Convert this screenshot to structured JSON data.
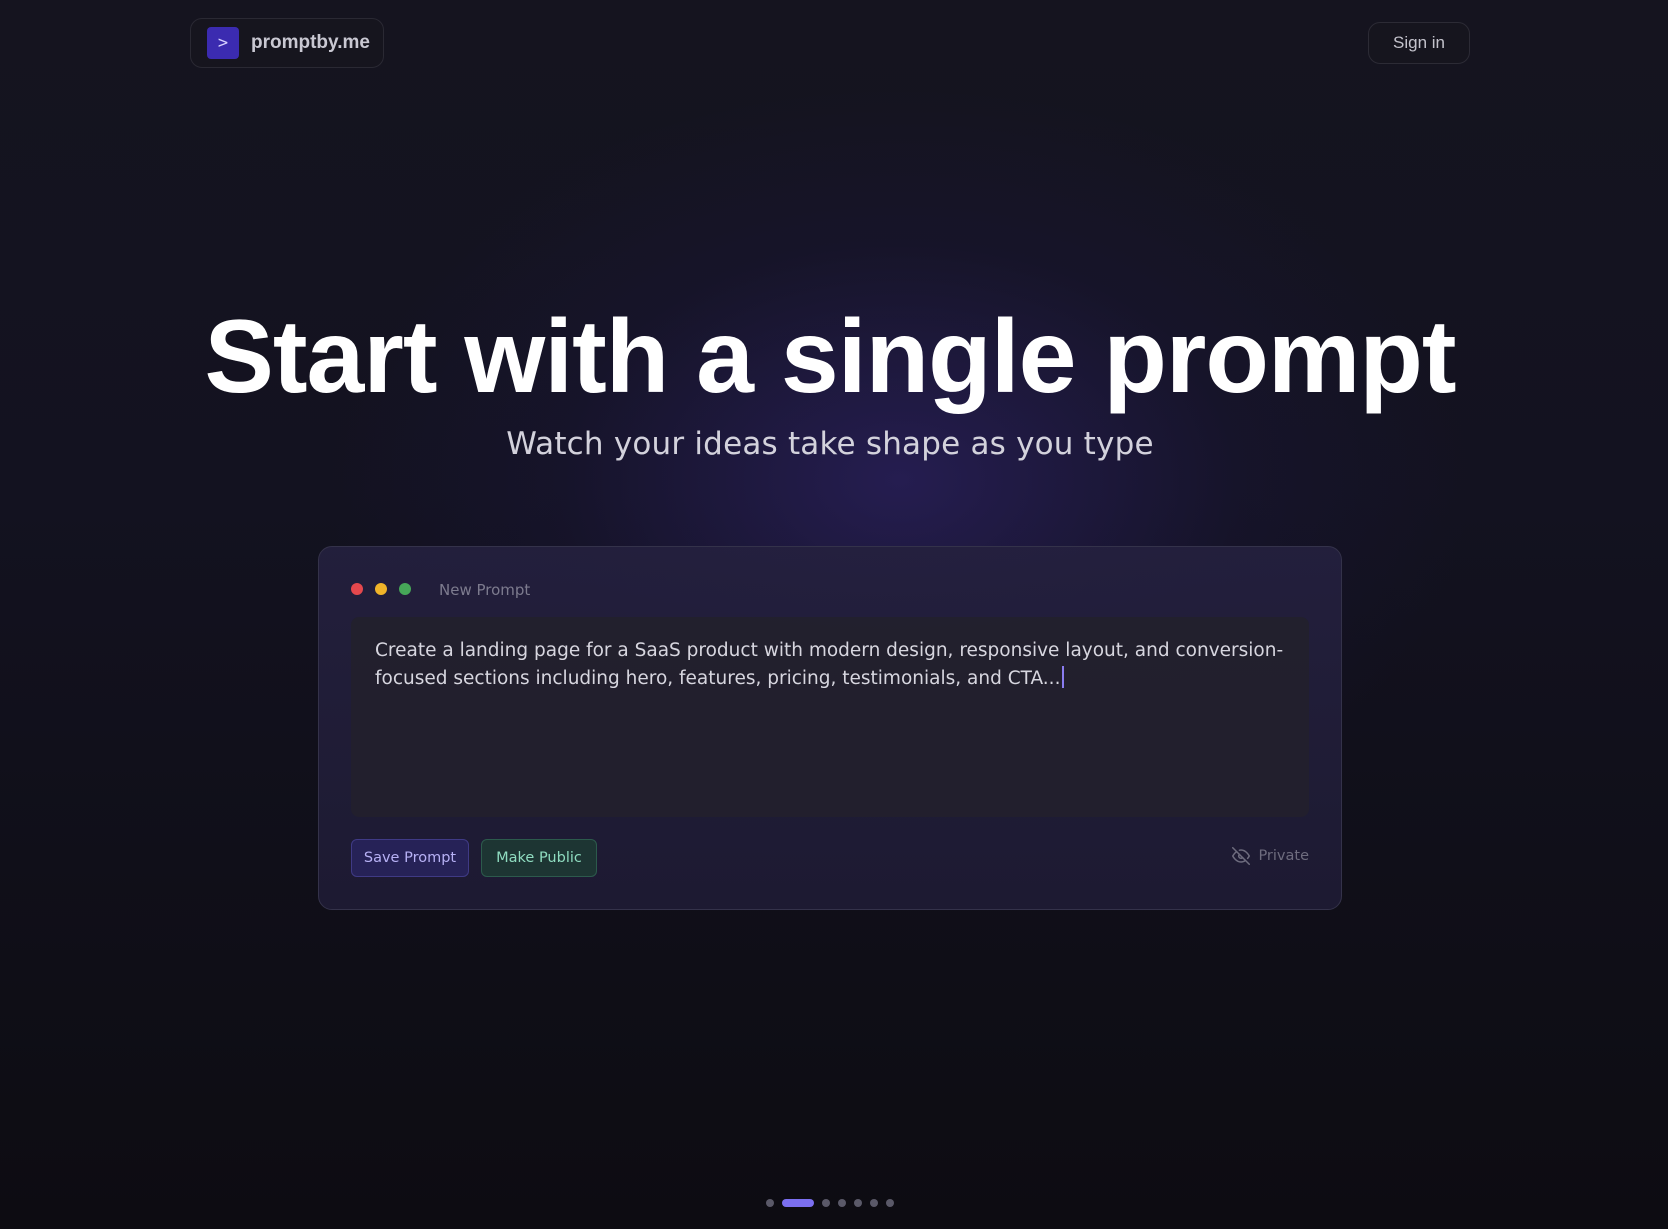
{
  "header": {
    "logo_glyph": ">",
    "logo_text": "promptby.me",
    "signin_label": "Sign in"
  },
  "hero": {
    "title": "Start with a single prompt",
    "subtitle": "Watch your ideas take shape as you type"
  },
  "editor": {
    "window_title": "New Prompt",
    "prompt_text": "Create a landing page for a SaaS product with modern design, responsive layout, and conversion-focused sections including hero, features, pricing, testimonials, and CTA...",
    "save_label": "Save Prompt",
    "public_label": "Make Public",
    "visibility_label": "Private",
    "visibility_icon": "eye-off-icon"
  },
  "pagination": {
    "total": 7,
    "active_index": 1
  },
  "colors": {
    "accent": "#7b6ff0",
    "logo_bg": "#3b2bb0",
    "save_bg": "#262257",
    "public_bg": "#1d3533",
    "dot_red": "#e5484d",
    "dot_yellow": "#f0b429",
    "dot_green": "#46a758"
  }
}
